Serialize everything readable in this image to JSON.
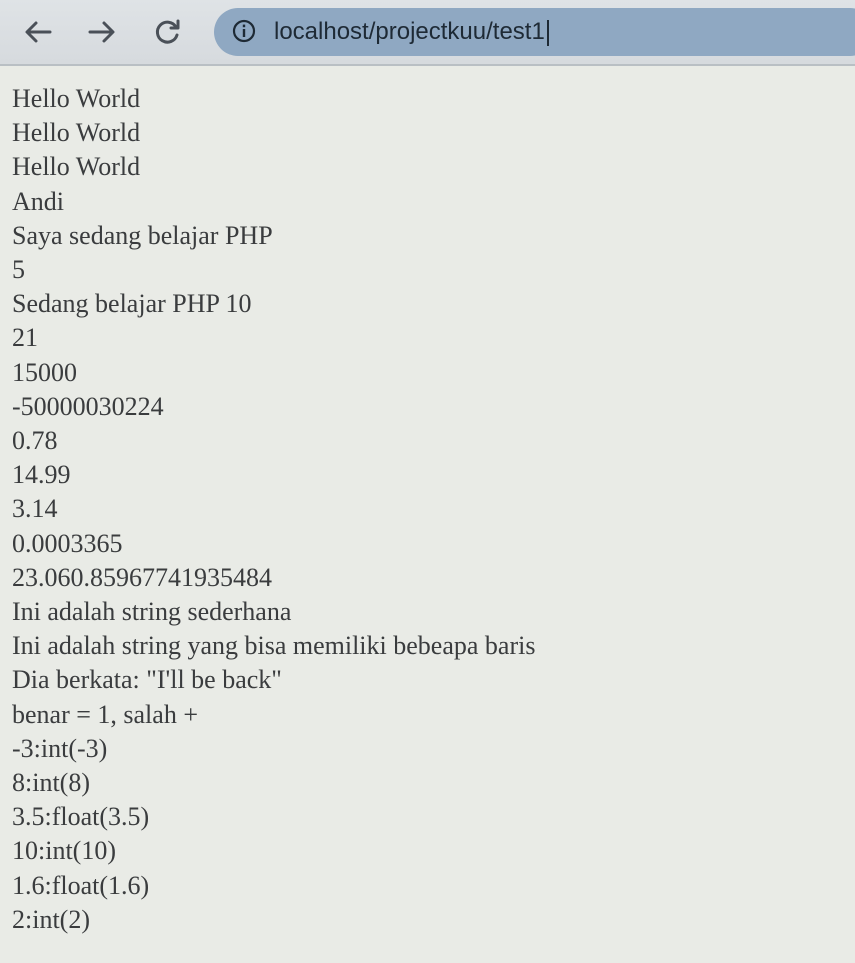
{
  "browser": {
    "address": "localhost/projectkuu/test1",
    "back_icon": "arrow-left-icon",
    "forward_icon": "arrow-right-icon",
    "reload_icon": "reload-icon",
    "info_icon": "info-icon"
  },
  "output_lines": [
    "Hello World",
    "Hello World",
    "Hello World",
    "Andi",
    "Saya sedang belajar PHP",
    "5",
    "Sedang belajar PHP 10",
    "21",
    "15000",
    "-50000030224",
    "0.78",
    "14.99",
    "3.14",
    "0.0003365",
    "23.060.85967741935484",
    "Ini adalah string sederhana",
    "Ini adalah string yang bisa memiliki bebeapa baris",
    "Dia berkata: \"I'll be back\"",
    "benar = 1, salah +",
    "-3:int(-3)",
    "8:int(8)",
    "3.5:float(3.5)",
    "10:int(10)",
    "1.6:float(1.6)",
    "2:int(2)"
  ]
}
